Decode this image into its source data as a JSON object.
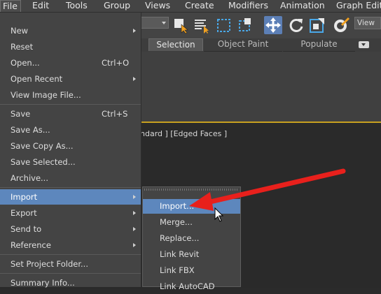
{
  "menubar": {
    "items": [
      {
        "label": "File",
        "active": true
      },
      {
        "label": "Edit"
      },
      {
        "label": "Tools"
      },
      {
        "label": "Group"
      },
      {
        "label": "Views"
      },
      {
        "label": "Create"
      },
      {
        "label": "Modifiers"
      },
      {
        "label": "Animation"
      },
      {
        "label": "Graph Editor"
      }
    ]
  },
  "toolbar": {
    "view_label": "View",
    "icons": [
      "select-object-icon",
      "select-by-name-icon",
      "rectangular-selection-icon",
      "window-crossing-icon",
      "select-and-move-icon",
      "select-and-rotate-icon",
      "select-and-scale-icon",
      "reference-coordinate-icon"
    ]
  },
  "ribbon": {
    "tabs": [
      "Selection",
      "Object Paint",
      "Populate"
    ]
  },
  "viewport": {
    "label": "ndard ] [Edged Faces ]"
  },
  "file_menu": {
    "items": [
      {
        "label": "New",
        "shortcut": "",
        "submenu": true
      },
      {
        "label": "Reset",
        "shortcut": "",
        "submenu": false
      },
      {
        "label": "Open...",
        "shortcut": "Ctrl+O",
        "submenu": false
      },
      {
        "label": "Open Recent",
        "shortcut": "",
        "submenu": true
      },
      {
        "label": "View Image File...",
        "shortcut": "",
        "submenu": false
      },
      {
        "label": "Save",
        "shortcut": "Ctrl+S",
        "submenu": false
      },
      {
        "label": "Save As...",
        "shortcut": "",
        "submenu": false
      },
      {
        "label": "Save Copy As...",
        "shortcut": "",
        "submenu": false
      },
      {
        "label": "Save Selected...",
        "shortcut": "",
        "submenu": false
      },
      {
        "label": "Archive...",
        "shortcut": "",
        "submenu": false
      },
      {
        "label": "Import",
        "shortcut": "",
        "submenu": true,
        "highlighted": true
      },
      {
        "label": "Export",
        "shortcut": "",
        "submenu": true
      },
      {
        "label": "Send to",
        "shortcut": "",
        "submenu": true
      },
      {
        "label": "Reference",
        "shortcut": "",
        "submenu": true
      },
      {
        "label": "Set Project Folder...",
        "shortcut": "",
        "submenu": false
      },
      {
        "label": "Summary Info...",
        "shortcut": "",
        "submenu": false
      }
    ]
  },
  "import_submenu": {
    "items": [
      {
        "label": "Import...",
        "highlighted": true
      },
      {
        "label": "Merge..."
      },
      {
        "label": "Replace..."
      },
      {
        "label": "Link Revit"
      },
      {
        "label": "Link FBX"
      },
      {
        "label": "Link AutoCAD"
      }
    ]
  },
  "annotation": {
    "arrow_color": "#e8201c"
  },
  "colors": {
    "highlight": "#5d87bd",
    "menu_bg": "#444444"
  }
}
